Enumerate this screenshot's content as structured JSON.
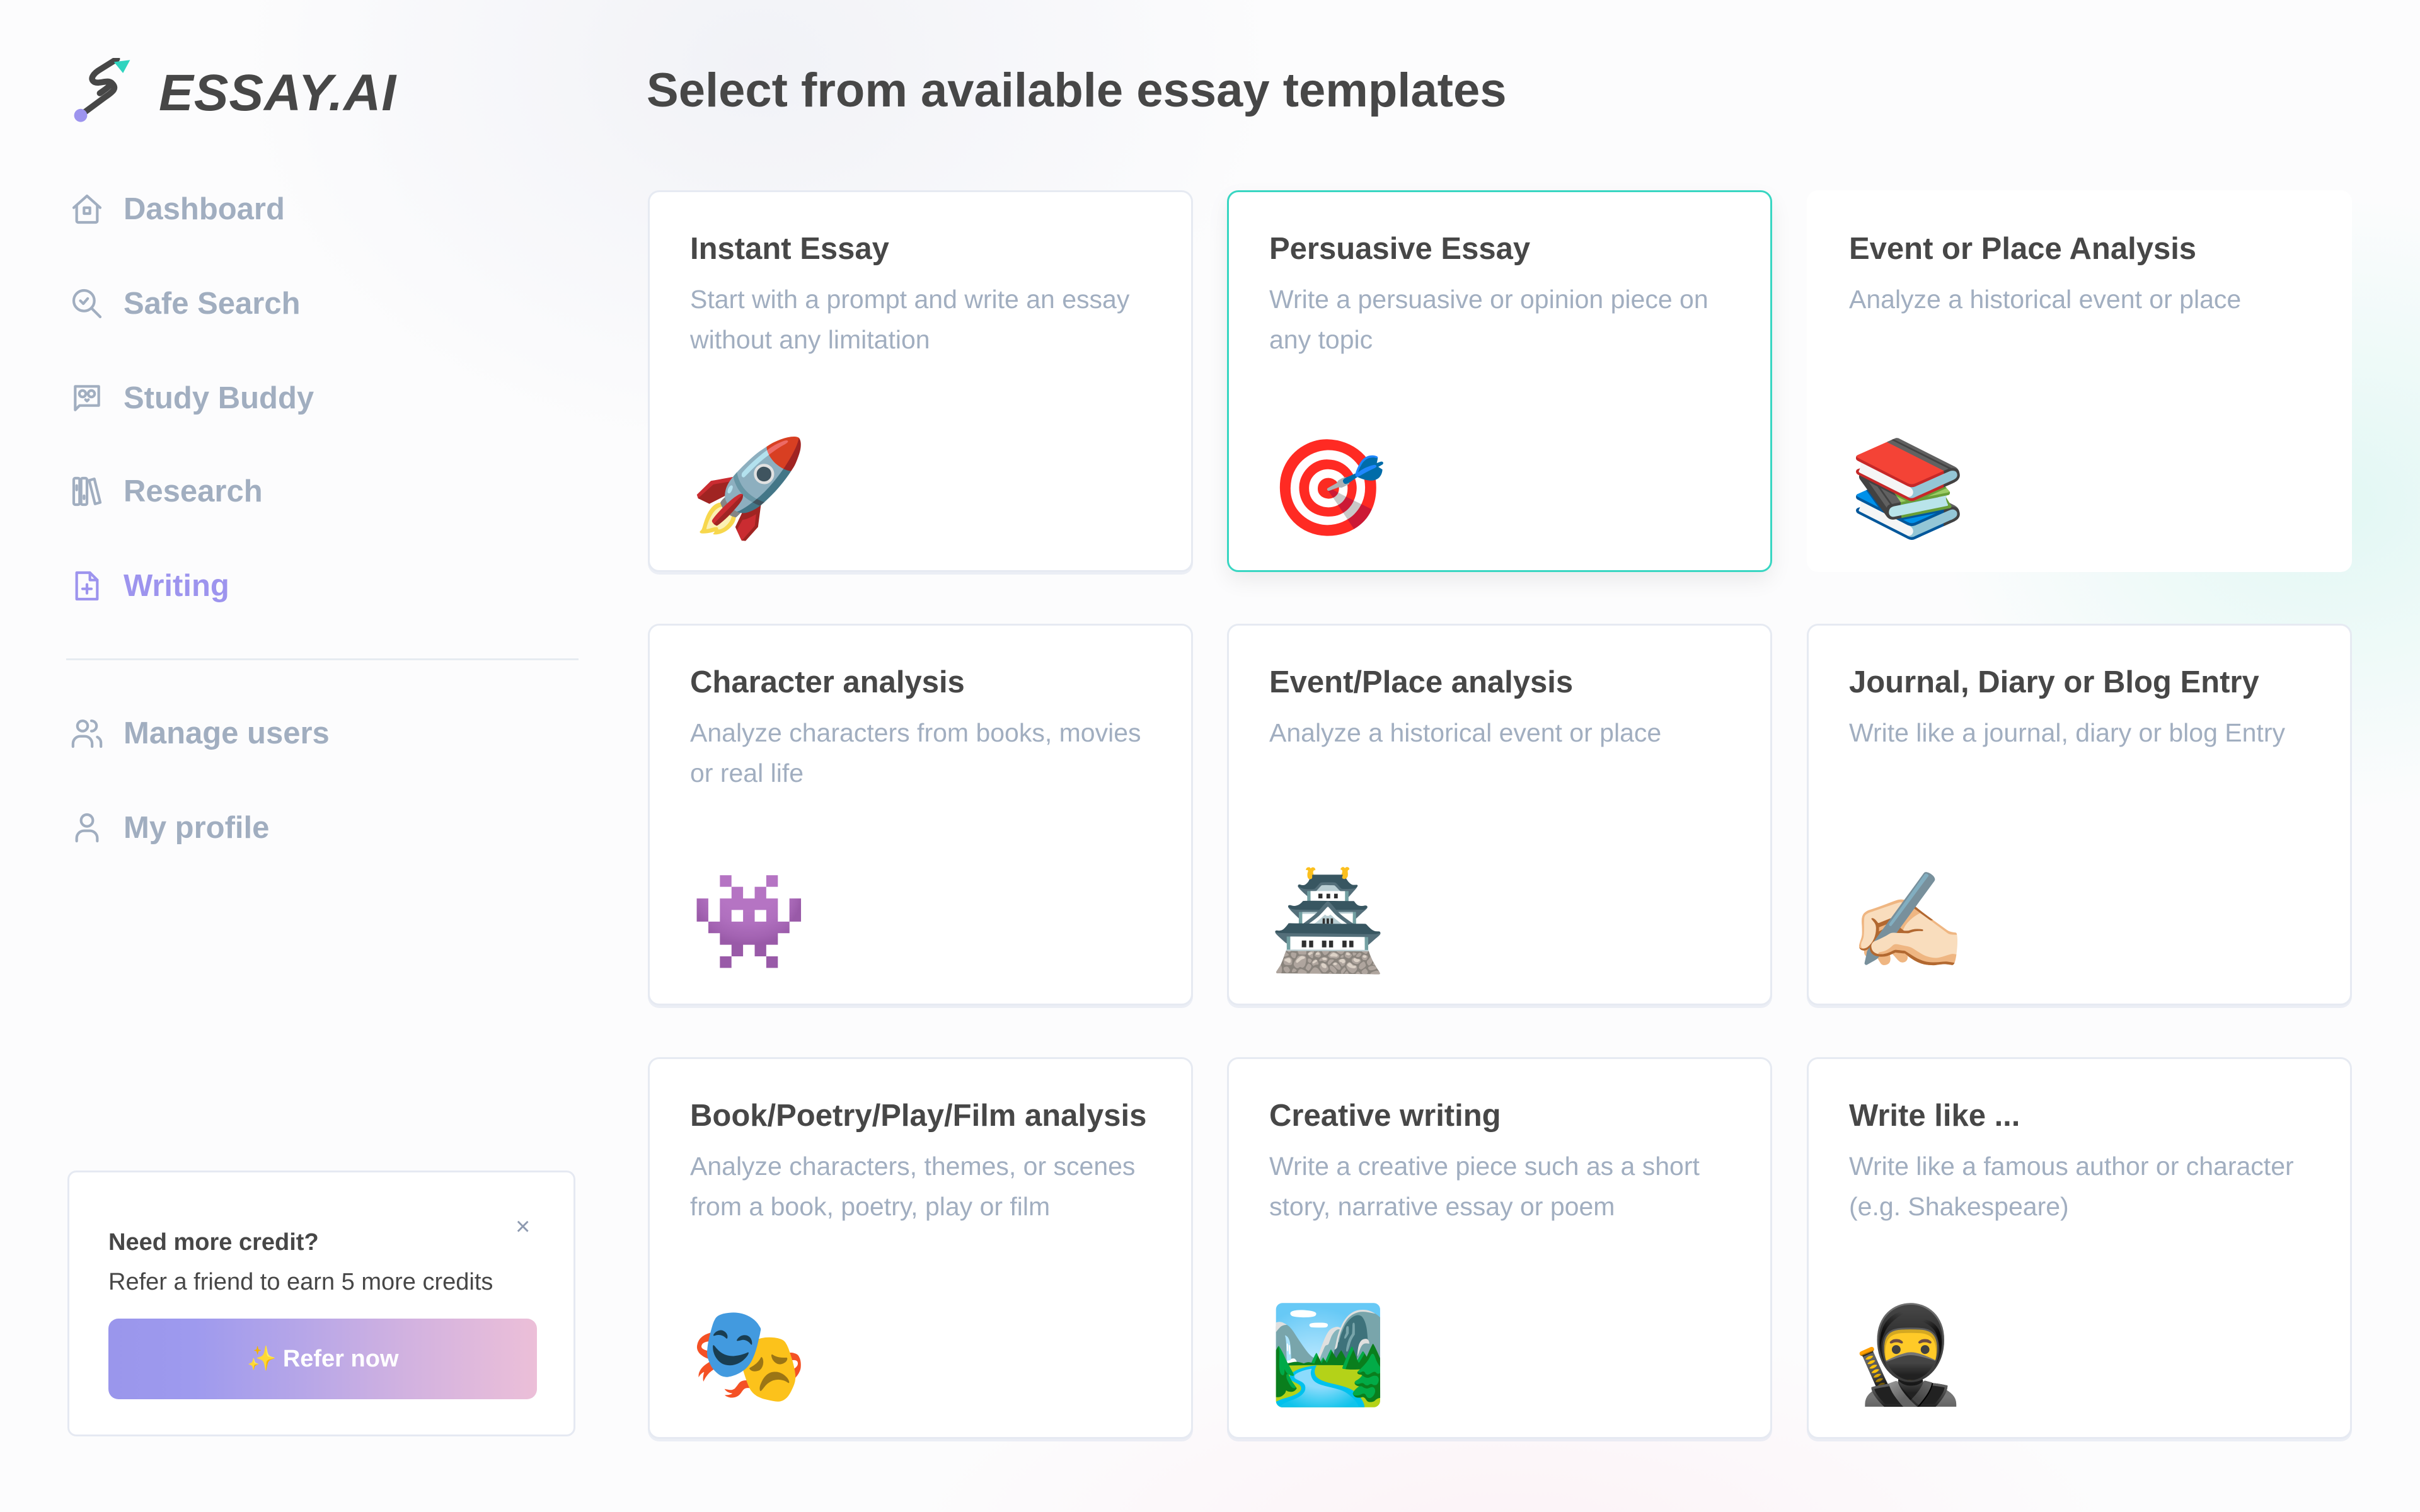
{
  "brand": {
    "name": "ESSAY.AI",
    "accent": "#9d94ee",
    "teal": "#2fd4bf"
  },
  "sidebar": {
    "items": [
      {
        "label": "Dashboard",
        "icon": "home-icon",
        "active": false
      },
      {
        "label": "Safe Search",
        "icon": "search-check-icon",
        "active": false
      },
      {
        "label": "Study Buddy",
        "icon": "owl-chat-icon",
        "active": false
      },
      {
        "label": "Research",
        "icon": "books-icon",
        "active": false
      },
      {
        "label": "Writing",
        "icon": "file-plus-icon",
        "active": true
      }
    ],
    "secondary_items": [
      {
        "label": "Manage users",
        "icon": "users-icon"
      },
      {
        "label": "My profile",
        "icon": "user-icon"
      }
    ]
  },
  "credit_card": {
    "title": "Need more credit?",
    "body": "Refer a friend to earn 5 more credits",
    "close": "×",
    "button_icon": "✨",
    "button_label": "Refer now"
  },
  "main": {
    "title": "Select from available essay templates",
    "templates": [
      {
        "title": "Instant Essay",
        "description": "Start with a prompt and write an essay without any limitation",
        "emoji": "🚀",
        "icon": "rocket-icon",
        "state": "default"
      },
      {
        "title": "Persuasive Essay",
        "description": "Write a persuasive or opinion piece on any topic",
        "emoji": "🎯",
        "icon": "target-icon",
        "state": "selected"
      },
      {
        "title": "Event or Place Analysis",
        "description": "Analyze a historical event or place",
        "emoji": "📚",
        "icon": "books-emoji-icon",
        "state": "plain"
      },
      {
        "title": "Character analysis",
        "description": "Analyze characters from books, movies or real life",
        "emoji": "👾",
        "icon": "alien-monster-icon",
        "state": "default"
      },
      {
        "title": "Event/Place analysis",
        "description": "Analyze a historical event or place",
        "emoji": "🏯",
        "icon": "castle-icon",
        "state": "default"
      },
      {
        "title": "Journal, Diary or Blog Entry",
        "description": "Write like a journal, diary or blog Entry",
        "emoji": "✍🏻",
        "icon": "writing-hand-icon",
        "state": "default"
      },
      {
        "title": "Book/Poetry/Play/Film analysis",
        "description": "Analyze characters, themes, or scenes from a book, poetry, play or film",
        "emoji": "🎭",
        "icon": "theater-masks-icon",
        "state": "default"
      },
      {
        "title": "Creative writing",
        "description": "Write a creative piece such as a short story, narrative essay or poem",
        "emoji": "🏞️",
        "icon": "landscape-picture-icon",
        "state": "default"
      },
      {
        "title": "Write like ...",
        "description": "Write like a famous author or character (e.g. Shakespeare)",
        "emoji": "🥷",
        "icon": "ninja-icon",
        "state": "default"
      }
    ]
  }
}
